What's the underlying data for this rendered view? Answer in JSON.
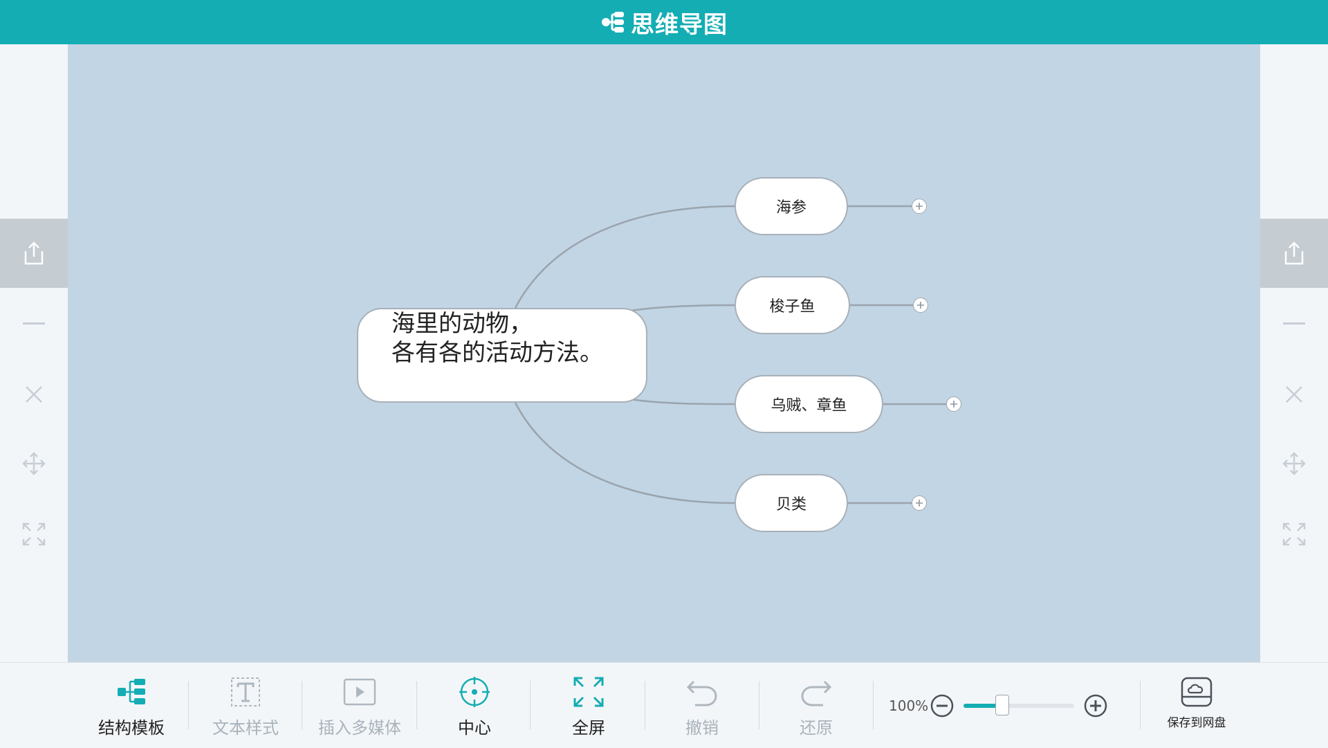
{
  "header": {
    "app_title": "思维导图",
    "color": "#14adb4"
  },
  "side_tools": [
    "share-icon",
    "minus-icon",
    "close-icon",
    "move-icon",
    "fit-screen-icon"
  ],
  "mindmap": {
    "root": {
      "line1": "海里的动物，",
      "line2": "各有各的活动方法。"
    },
    "branches": [
      {
        "label": "海参"
      },
      {
        "label": "梭子鱼"
      },
      {
        "label": "乌贼、章鱼"
      },
      {
        "label": "贝类"
      }
    ]
  },
  "toolbar": {
    "structure_template": "结构模板",
    "text_style": "文本样式",
    "insert_media": "插入多媒体",
    "center": "中心",
    "fullscreen": "全屏",
    "undo": "撤销",
    "redo": "还原",
    "save_to_cloud": "保存到网盘"
  },
  "zoom": {
    "percent_label": "100%",
    "level_fraction": 0.35
  }
}
